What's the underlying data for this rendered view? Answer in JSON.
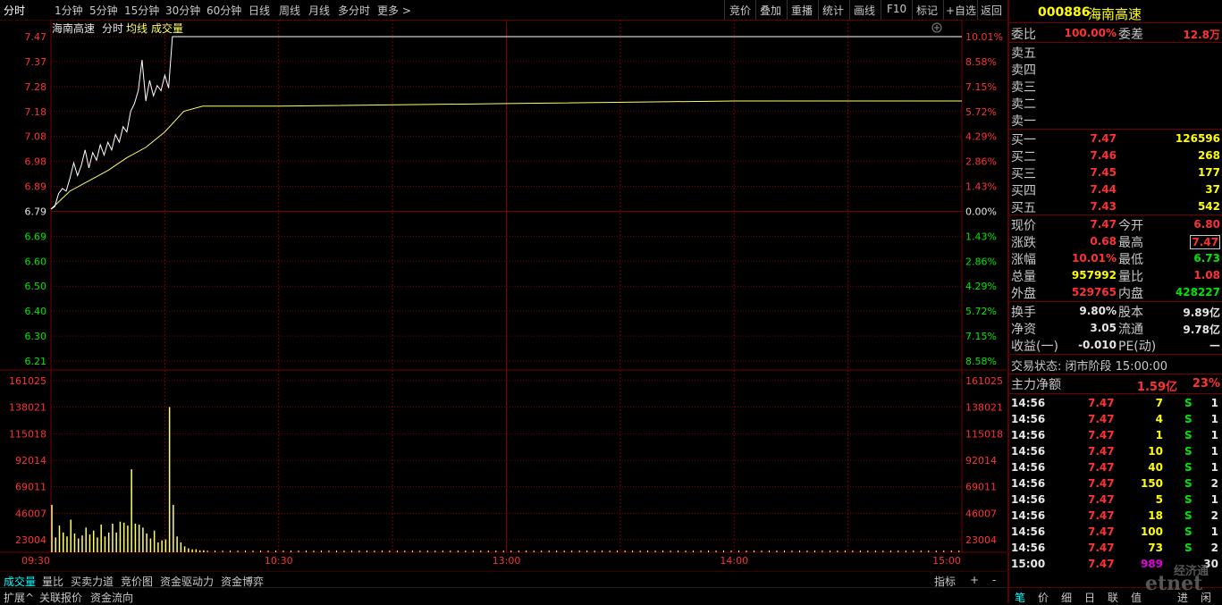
{
  "timeframes": [
    "分时",
    "1分钟",
    "5分钟",
    "15分钟",
    "30分钟",
    "60分钟",
    "日线",
    "周线",
    "月线",
    "多分时",
    "更多 >"
  ],
  "toolbar": [
    "竞价",
    "叠加",
    "重播",
    "统计",
    "画线",
    "F10",
    "标记",
    "+自选",
    "返回"
  ],
  "chart_header": {
    "name": "海南高速",
    "mode": "分时",
    "avg": "均线",
    "vol": "成交量"
  },
  "price_ticks": [
    "7.47",
    "7.37",
    "7.28",
    "7.18",
    "7.08",
    "6.98",
    "6.89",
    "6.79",
    "6.69",
    "6.60",
    "6.50",
    "6.40",
    "6.30",
    "6.21"
  ],
  "pct_ticks": [
    "10.01%",
    "8.58%",
    "7.15%",
    "5.72%",
    "4.29%",
    "2.86%",
    "1.43%",
    "0.00%",
    "1.43%",
    "2.86%",
    "4.29%",
    "5.72%",
    "7.15%",
    "8.58%"
  ],
  "vol_ticks": [
    "161025",
    "138021",
    "115018",
    "92014",
    "69011",
    "46007",
    "23004"
  ],
  "time_ticks": [
    "09:30",
    "10:30",
    "13:00",
    "14:00",
    "15:00"
  ],
  "bottom_tabs": [
    "成交量",
    "量比",
    "买卖力道",
    "竞价图",
    "资金驱动力",
    "资金博弈"
  ],
  "bottom_right": [
    "指标",
    "+",
    "-"
  ],
  "bottom_row": [
    "扩展^",
    "关联报价",
    "资金流向"
  ],
  "colors": {
    "price_line": "#ffffff",
    "avg_line": "#ffff66",
    "vol_bar": "#ffff66",
    "grid": "#7a0000",
    "up": "#ff3232",
    "down": "#00e600"
  },
  "chart_data": {
    "type": "line",
    "price": {
      "x": [
        0,
        1,
        2,
        3,
        4,
        5,
        6,
        7,
        8,
        9,
        10,
        11,
        12,
        13,
        14,
        15,
        16,
        17,
        18,
        19,
        20,
        21,
        22,
        23,
        24,
        25,
        26,
        27,
        28,
        29,
        30,
        31,
        32,
        33,
        34,
        35,
        240
      ],
      "y": [
        6.8,
        6.81,
        6.86,
        6.88,
        6.87,
        6.92,
        6.98,
        6.93,
        6.97,
        7.03,
        6.96,
        7.02,
        6.99,
        7.05,
        7.01,
        7.06,
        7.03,
        7.09,
        7.06,
        7.12,
        7.1,
        7.18,
        7.21,
        7.26,
        7.38,
        7.22,
        7.3,
        7.24,
        7.28,
        7.26,
        7.32,
        7.27,
        7.47,
        7.47,
        7.47,
        7.47,
        7.47
      ]
    },
    "avg": {
      "x": [
        0,
        5,
        10,
        15,
        20,
        25,
        30,
        35,
        40,
        60,
        120,
        180,
        240
      ],
      "y": [
        6.8,
        6.87,
        6.91,
        6.95,
        7.0,
        7.04,
        7.1,
        7.18,
        7.2,
        7.2,
        7.21,
        7.22,
        7.22
      ]
    },
    "volume": {
      "x": [
        0,
        1,
        2,
        3,
        4,
        5,
        6,
        7,
        8,
        9,
        10,
        11,
        12,
        13,
        14,
        15,
        16,
        17,
        18,
        19,
        20,
        21,
        22,
        23,
        24,
        25,
        26,
        27,
        28,
        29,
        30,
        31,
        32,
        33,
        34,
        35,
        36,
        37,
        38,
        39,
        40
      ],
      "y": [
        48000,
        15000,
        27000,
        20000,
        16000,
        33000,
        19000,
        14000,
        17000,
        25000,
        18000,
        22000,
        15000,
        28000,
        16000,
        20000,
        29000,
        20000,
        31000,
        30000,
        27000,
        84000,
        29000,
        28000,
        25000,
        19000,
        14000,
        22000,
        10000,
        12000,
        13000,
        147000,
        48000,
        16000,
        10000,
        6000,
        4000,
        3000,
        3000,
        2000,
        2000
      ]
    },
    "ylim_price": [
      6.21,
      7.47
    ],
    "ylim_vol": [
      0,
      161025
    ]
  },
  "panel": {
    "code": "000886",
    "name": "海南高速",
    "webi_label": "委比",
    "webi_value": "100.00%",
    "wecha_label": "委差",
    "wecha_value": "12.8万",
    "sells": [
      "卖五",
      "卖四",
      "卖三",
      "卖二",
      "卖一"
    ],
    "buys": [
      {
        "label": "买一",
        "price": "7.47",
        "vol": "126596"
      },
      {
        "label": "买二",
        "price": "7.46",
        "vol": "268"
      },
      {
        "label": "买三",
        "price": "7.45",
        "vol": "177"
      },
      {
        "label": "买四",
        "price": "7.44",
        "vol": "37"
      },
      {
        "label": "买五",
        "price": "7.43",
        "vol": "542"
      }
    ],
    "stats": [
      {
        "l1": "现价",
        "v1": "7.47",
        "c1": "red",
        "l2": "今开",
        "v2": "6.80",
        "c2": "red"
      },
      {
        "l1": "涨跌",
        "v1": "0.68",
        "c1": "red",
        "l2": "最高",
        "v2": "7.47",
        "c2": "red"
      },
      {
        "l1": "涨幅",
        "v1": "10.01%",
        "c1": "red",
        "l2": "最低",
        "v2": "6.73",
        "c2": "grn"
      },
      {
        "l1": "总量",
        "v1": "957992",
        "c1": "yel",
        "l2": "量比",
        "v2": "1.08",
        "c2": "red"
      },
      {
        "l1": "外盘",
        "v1": "529765",
        "c1": "red",
        "l2": "内盘",
        "v2": "428227",
        "c2": "grn"
      }
    ],
    "stats2": [
      {
        "l1": "换手",
        "v1": "9.80%",
        "l2": "股本",
        "v2": "9.89亿"
      },
      {
        "l1": "净资",
        "v1": "3.05",
        "l2": "流通",
        "v2": "9.78亿"
      },
      {
        "l1": "收益(一)",
        "v1": "-0.010",
        "l2": "PE(动)",
        "v2": "—"
      }
    ],
    "status": "交易状态: 闭市阶段 15:00:00",
    "main_label": "主力净额",
    "main_value": "1.59亿",
    "main_pct": "23%",
    "ticks": [
      {
        "t": "14:56",
        "p": "7.47",
        "v": "7",
        "s": "S",
        "n": "1"
      },
      {
        "t": "14:56",
        "p": "7.47",
        "v": "4",
        "s": "S",
        "n": "1"
      },
      {
        "t": "14:56",
        "p": "7.47",
        "v": "1",
        "s": "S",
        "n": "1"
      },
      {
        "t": "14:56",
        "p": "7.47",
        "v": "10",
        "s": "S",
        "n": "1"
      },
      {
        "t": "14:56",
        "p": "7.47",
        "v": "40",
        "s": "S",
        "n": "1"
      },
      {
        "t": "14:56",
        "p": "7.47",
        "v": "150",
        "s": "S",
        "n": "2"
      },
      {
        "t": "14:56",
        "p": "7.47",
        "v": "5",
        "s": "S",
        "n": "1"
      },
      {
        "t": "14:56",
        "p": "7.47",
        "v": "18",
        "s": "S",
        "n": "2"
      },
      {
        "t": "14:56",
        "p": "7.47",
        "v": "100",
        "s": "S",
        "n": "1"
      },
      {
        "t": "14:56",
        "p": "7.47",
        "v": "73",
        "s": "S",
        "n": "2"
      },
      {
        "t": "15:00",
        "p": "7.47",
        "v": "989",
        "s": "",
        "n": "30"
      }
    ],
    "tabs": [
      "笔",
      "价",
      "细",
      "日",
      "联",
      "值",
      "进",
      "闲"
    ]
  },
  "watermark": "etnet",
  "watermark_small": "经济通"
}
